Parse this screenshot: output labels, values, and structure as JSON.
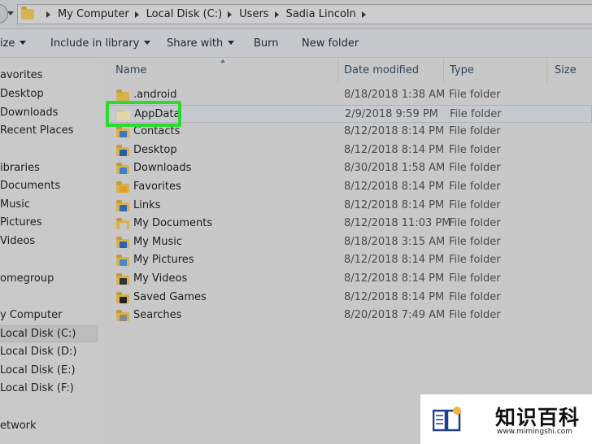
{
  "address": {
    "breadcrumbs": [
      "My Computer",
      "Local Disk (C:)",
      "Users",
      "Sadia Lincoln"
    ]
  },
  "toolbar": {
    "organize": "ize",
    "include_in_library": "Include in library",
    "share_with": "Share with",
    "burn": "Burn",
    "new_folder": "New folder"
  },
  "sidebar": {
    "favorites": "avorites",
    "desktop": "Desktop",
    "downloads": "Downloads",
    "recent_places": "Recent Places",
    "libraries": "ibraries",
    "documents": "Documents",
    "music": "Music",
    "pictures": "Pictures",
    "videos": "Videos",
    "homegroup": "omegroup",
    "computer": "y Computer",
    "disk_c": "Local Disk (C:)",
    "disk_d": "Local Disk (D:)",
    "disk_e": "Local Disk (E:)",
    "disk_f": "Local Disk (F:)",
    "network": "etwork"
  },
  "columns": {
    "name": "Name",
    "date_modified": "Date modified",
    "type": "Type",
    "size": "Size"
  },
  "files": [
    {
      "name": ".android",
      "date": "8/18/2018 1:38 AM",
      "type": "File folder",
      "icon": "folder-icon"
    },
    {
      "name": "AppData",
      "date": "2/9/2018 9:59 PM",
      "type": "File folder",
      "icon": "folder-icon"
    },
    {
      "name": "Contacts",
      "date": "8/12/2018 8:14 PM",
      "type": "File folder",
      "icon": "contacts-folder-icon"
    },
    {
      "name": "Desktop",
      "date": "8/12/2018 8:14 PM",
      "type": "File folder",
      "icon": "desktop-folder-icon"
    },
    {
      "name": "Downloads",
      "date": "8/30/2018 1:58 AM",
      "type": "File folder",
      "icon": "downloads-folder-icon"
    },
    {
      "name": "Favorites",
      "date": "8/12/2018 8:14 PM",
      "type": "File folder",
      "icon": "favorites-folder-icon"
    },
    {
      "name": "Links",
      "date": "8/12/2018 8:14 PM",
      "type": "File folder",
      "icon": "links-folder-icon"
    },
    {
      "name": "My Documents",
      "date": "8/12/2018 11:03 PM",
      "type": "File folder",
      "icon": "documents-folder-icon"
    },
    {
      "name": "My Music",
      "date": "8/18/2018 3:15 AM",
      "type": "File folder",
      "icon": "music-folder-icon"
    },
    {
      "name": "My Pictures",
      "date": "8/12/2018 8:14 PM",
      "type": "File folder",
      "icon": "pictures-folder-icon"
    },
    {
      "name": "My Videos",
      "date": "8/12/2018 8:14 PM",
      "type": "File folder",
      "icon": "videos-folder-icon"
    },
    {
      "name": "Saved Games",
      "date": "8/12/2018 8:14 PM",
      "type": "File folder",
      "icon": "saved-games-folder-icon"
    },
    {
      "name": "Searches",
      "date": "8/20/2018 7:49 AM",
      "type": "File folder",
      "icon": "searches-folder-icon"
    }
  ],
  "watermark": {
    "title": "知识百科",
    "url": "www.mimingshi.com"
  },
  "colors": {
    "highlight": "#2bdc2e",
    "folder": "#d6b14d"
  }
}
